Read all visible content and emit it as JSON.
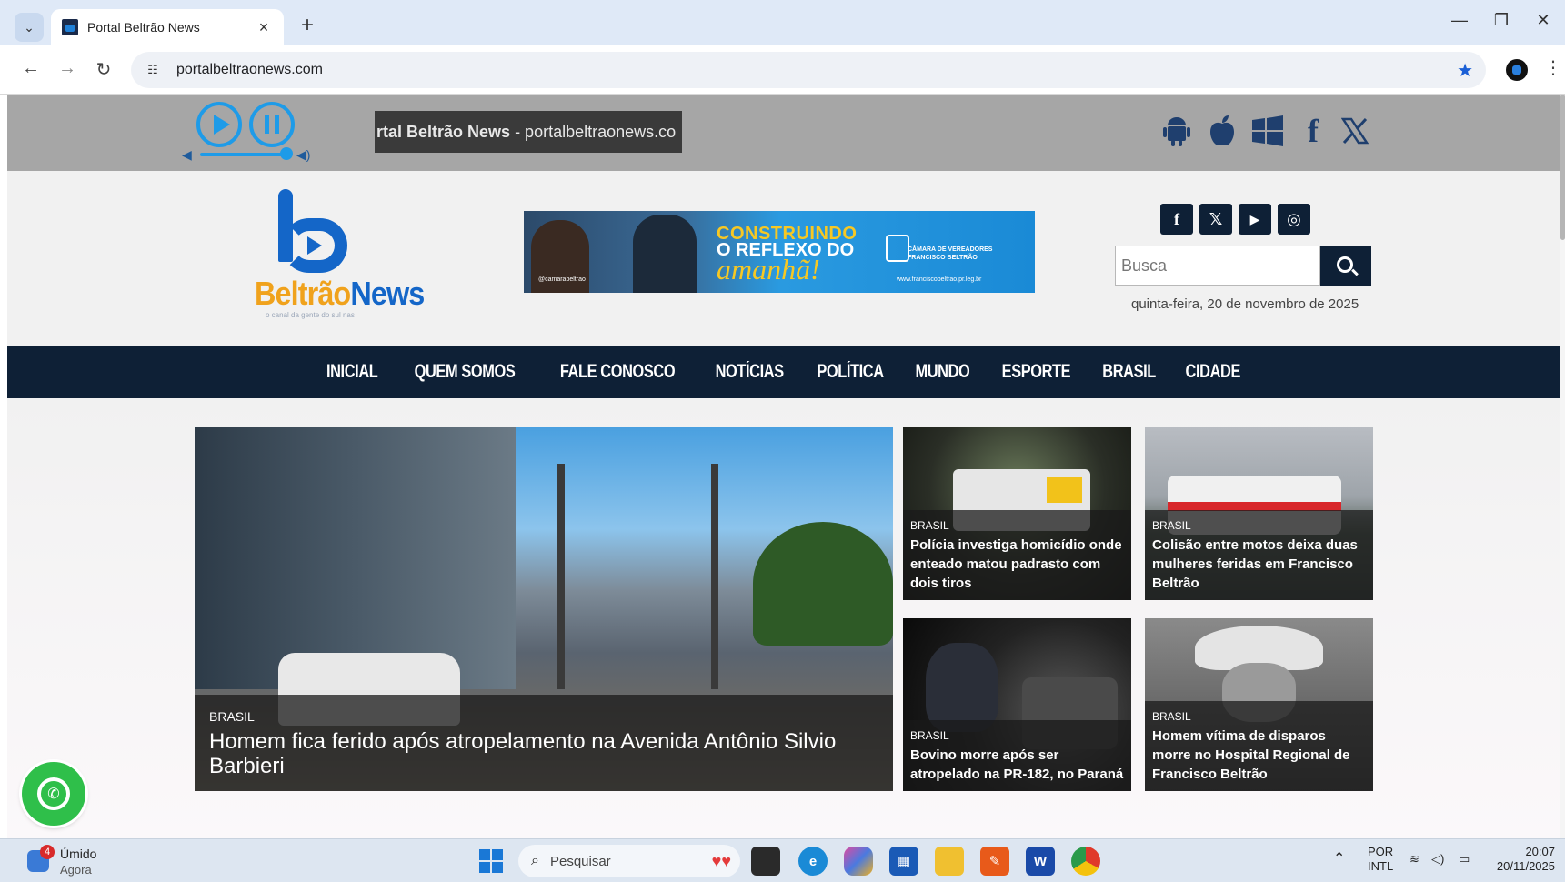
{
  "browser": {
    "tab_title": "Portal Beltrão News",
    "tab_close": "×",
    "new_tab": "+",
    "url": "portalbeltraonews.com"
  },
  "player": {
    "marquee_bold": "rtal Beltrão News",
    "marquee_rest": " - portalbeltraonews.co"
  },
  "header": {
    "logo_text_b": "Beltrão",
    "logo_text_n": "News",
    "logo_slogan": "o canal da gente do sul nas",
    "banner": {
      "line1": "CONSTRUINDO",
      "line2": "O REFLEXO DO",
      "line3": "amanhã!",
      "org": "CÂMARA DE VEREADORES FRANCISCO BELTRÃO",
      "handle": "@camarabeltrao",
      "site": "www.franciscobeltrao.pr.leg.br"
    },
    "social": {
      "facebook": "f",
      "x": "𝕏",
      "youtube": "▶",
      "instagram": "◎"
    },
    "search_placeholder": "Busca",
    "date": "quinta-feira, 20 de novembro de 2025"
  },
  "nav": [
    "INICIAL",
    "QUEM SOMOS",
    "FALE CONOSCO",
    "NOTÍCIAS",
    "POLÍTICA",
    "MUNDO",
    "ESPORTE",
    "BRASIL",
    "CIDADE"
  ],
  "articles": [
    {
      "category": "BRASIL",
      "headline": "Homem fica ferido após atropelamento na Avenida Antônio Silvio Barbieri"
    },
    {
      "category": "BRASIL",
      "headline": "Polícia investiga homicídio onde enteado matou padrasto com dois tiros"
    },
    {
      "category": "BRASIL",
      "headline": "Colisão entre motos deixa duas mulheres feridas em Francisco Beltrão"
    },
    {
      "category": "BRASIL",
      "headline": "Bovino morre após ser atropelado na PR-182, no Paraná"
    },
    {
      "category": "BRASIL",
      "headline": "Homem vítima de disparos morre no Hospital Regional de Francisco Beltrão"
    }
  ],
  "taskbar": {
    "weather_badge": "4",
    "weather_title": "Úmido",
    "weather_sub": "Agora",
    "search_label": "Pesquisar",
    "lang1": "POR",
    "lang2": "INTL",
    "time": "20:07",
    "date": "20/11/2025"
  },
  "colors": {
    "nav_bg": "#0e2036",
    "accent_blue": "#1e9be8",
    "logo_orange": "#f0a21c",
    "whatsapp_green": "#2fbf4a"
  }
}
